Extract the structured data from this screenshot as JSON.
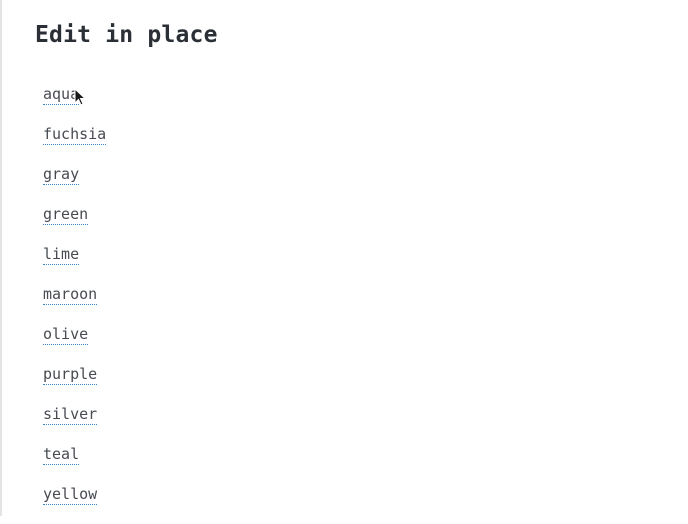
{
  "page": {
    "title": "Edit in place"
  },
  "items": [
    {
      "label": "aqua"
    },
    {
      "label": "fuchsia"
    },
    {
      "label": "gray"
    },
    {
      "label": "green"
    },
    {
      "label": "lime"
    },
    {
      "label": "maroon"
    },
    {
      "label": "olive"
    },
    {
      "label": "purple"
    },
    {
      "label": "silver"
    },
    {
      "label": "teal"
    },
    {
      "label": "yellow"
    }
  ],
  "colors": {
    "underline": "#3b82c4",
    "text": "#474b51",
    "heading": "#2b2f36"
  },
  "icons": {
    "cursor": "mouse-pointer-icon"
  }
}
